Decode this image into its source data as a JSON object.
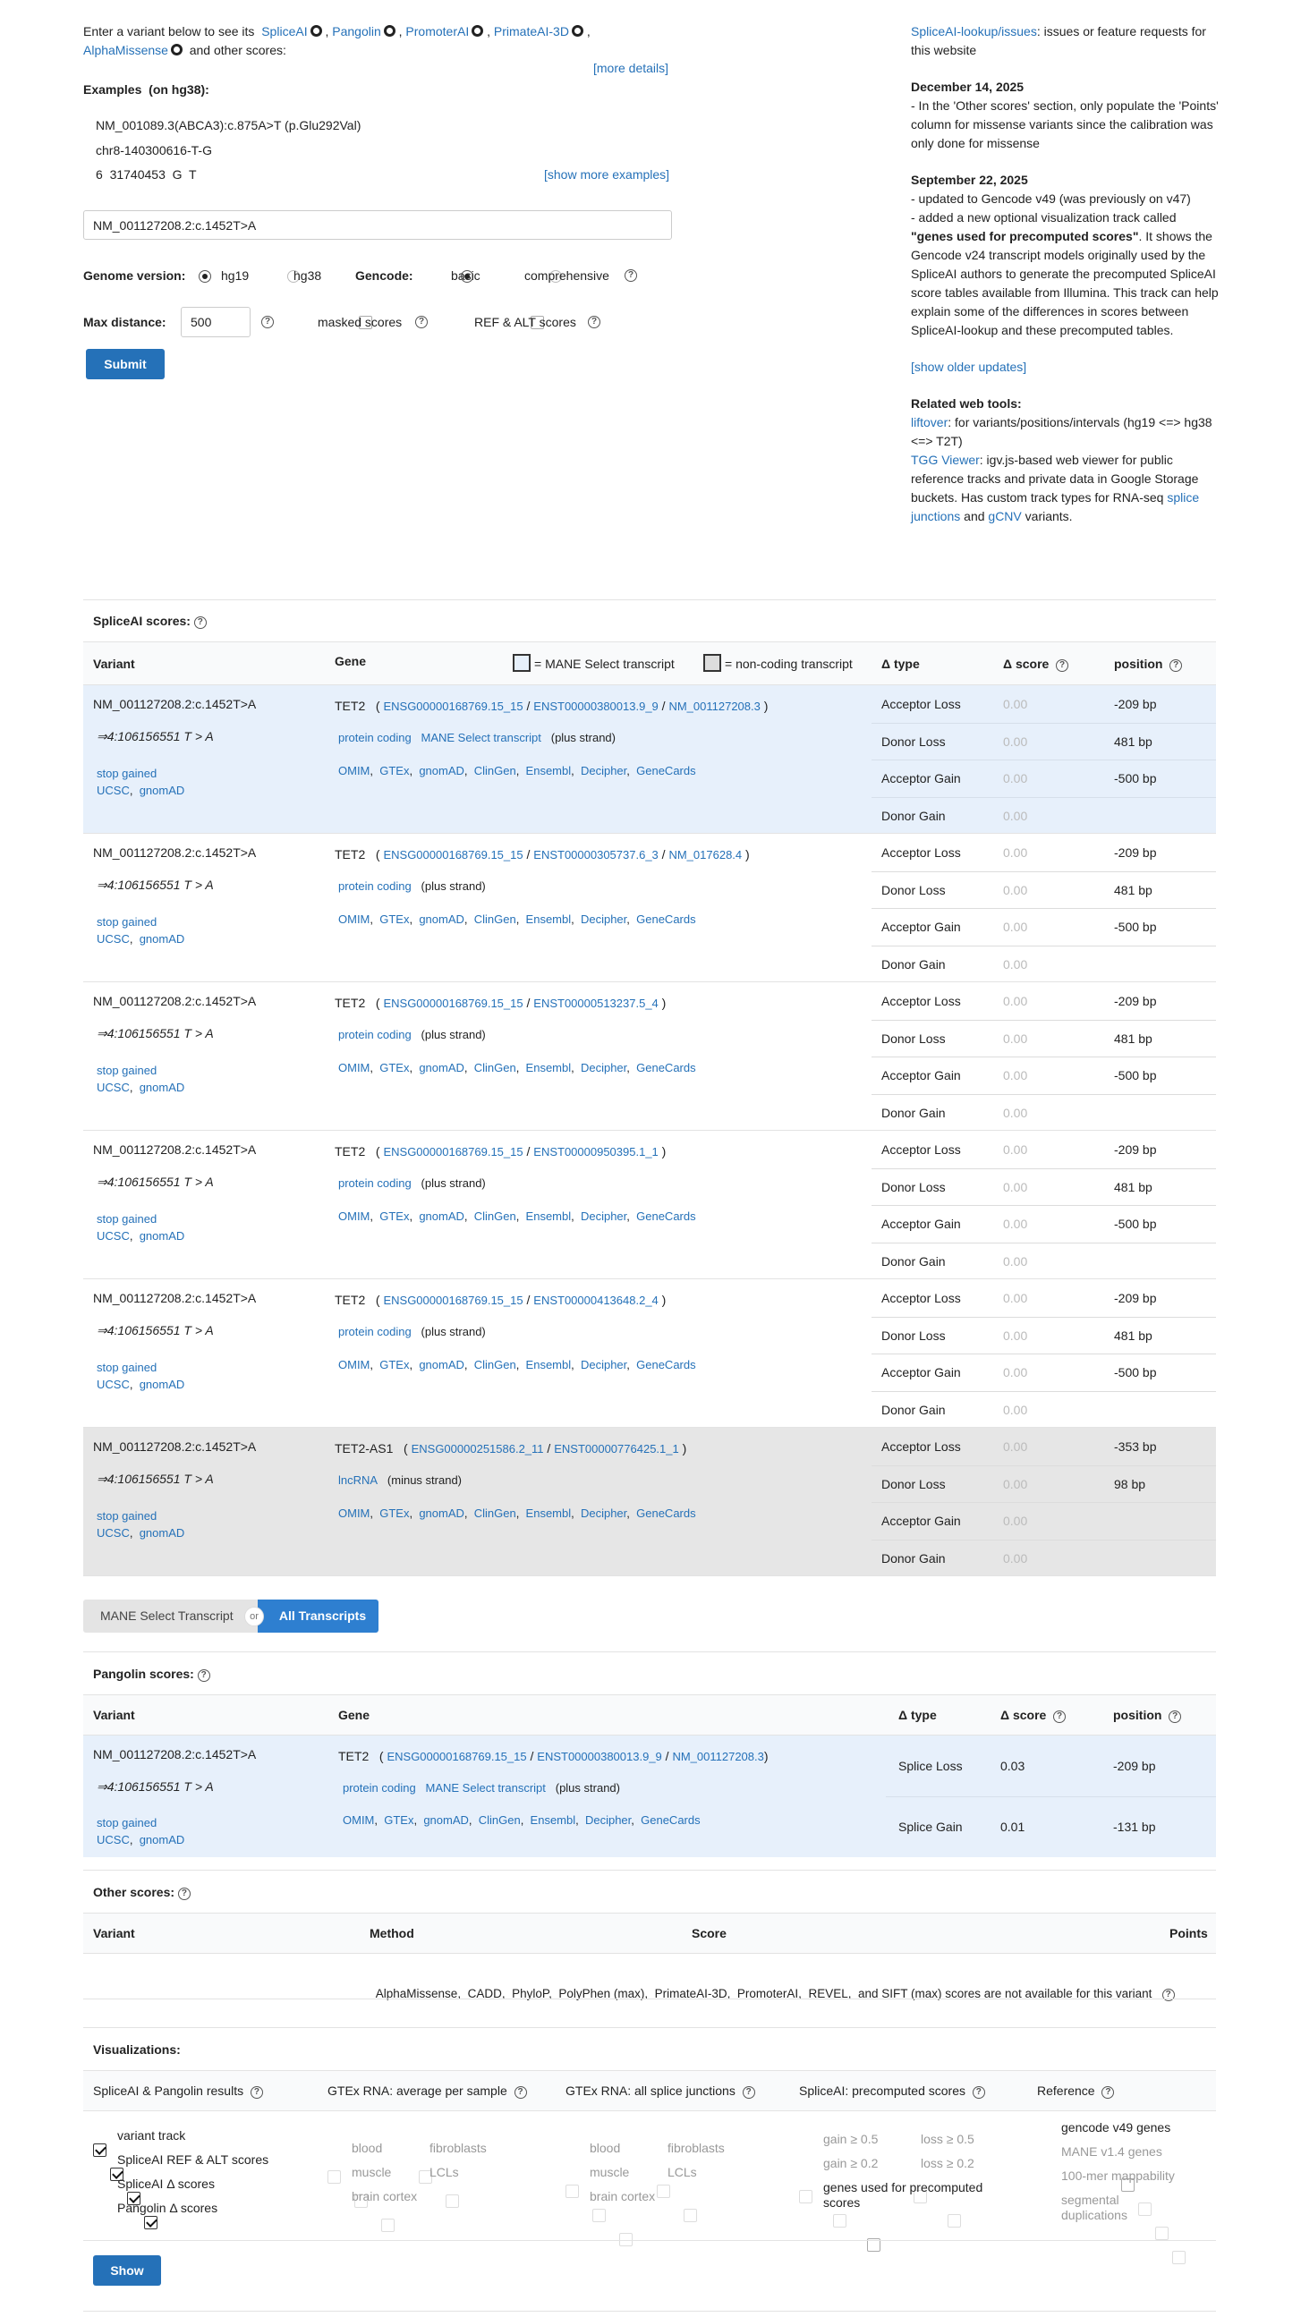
{
  "intro": {
    "prefix": "Enter a variant below to see its",
    "tools": [
      "SpliceAI",
      "Pangolin",
      "PromoterAI",
      "PrimateAI-3D",
      "AlphaMissense"
    ],
    "suffix": "and other scores:",
    "more_details": "[more details]"
  },
  "examples": {
    "heading": "Examples",
    "heading_note": "(on hg38):",
    "items": [
      "NM_001089.3(ABCA3):c.875A>T (p.Glu292Val)",
      "chr8-140300616-T-G",
      "6  31740453  G  T"
    ],
    "show_more": "[show more examples]"
  },
  "search": {
    "value": "NM_001127208.2:c.1452T>A"
  },
  "options": {
    "genome_label": "Genome version:",
    "genome": [
      "hg19",
      "hg38"
    ],
    "gencode_label": "Gencode:",
    "gencode": [
      "basic",
      "comprehensive"
    ],
    "maxdist_label": "Max distance:",
    "maxdist_value": "500",
    "masked": "masked scores",
    "refalt": "REF & ALT scores",
    "submit": "Submit"
  },
  "news": {
    "issues_link": "SpliceAI-lookup/issues",
    "issues_text": ": issues or feature requests for this website",
    "d1": "December 14, 2025",
    "d1_text": "- In the 'Other scores' section, only populate the 'Points' column for missense variants since the calibration was only done for missense",
    "d2": "September 22, 2025",
    "d2_l1": "- updated to Gencode v49 (was previously on v47)",
    "d2_l2a": "- added a new optional visualization track called",
    "d2_l2b": "\"genes used for precomputed scores\"",
    "d2_l2c": ". It shows the Gencode v24 transcript models originally used by the SpliceAI authors to generate the precomputed SpliceAI score tables available from Illumina. This track can help explain some of the differences in scores between SpliceAI-lookup and these precomputed tables.",
    "show_older": "[show older updates]",
    "related": "Related web tools:",
    "liftover": "liftover",
    "liftover_text": ": for variants/positions/intervals (hg19 <=> hg38 <=> T2T)",
    "igv": "TGG Viewer",
    "igv_text": ": igv.js-based web viewer for public reference tracks and private data in Google Storage buckets. Has custom track types for RNA-seq",
    "splice_junctions": "splice junctions",
    "and": "and",
    "gcnv": "gCNV",
    "variants": "variants."
  },
  "spliceai": {
    "title": "SpliceAI scores:",
    "col_variant": "Variant",
    "col_gene": "Gene",
    "mane_legend": "= MANE Select transcript",
    "noncoding_legend": "= non-coding transcript",
    "col_type": "Δ type",
    "col_score": "Δ score",
    "col_pos": "position",
    "variant": "NM_001127208.2:c.1452T>A",
    "variant_pos": "⇒4:106156551 T > A",
    "consequence": "stop gained",
    "ucsc": "UCSC",
    "gnomad": "gnomAD",
    "links": [
      "OMIM",
      "GTEx",
      "gnomAD",
      "ClinGen",
      "Ensembl",
      "Decipher",
      "GeneCards"
    ],
    "types": [
      "Acceptor Loss",
      "Donor Loss",
      "Acceptor Gain",
      "Donor Gain"
    ],
    "rows": [
      {
        "gene": "TET2",
        "ensg": "ENSG00000168769.15_15",
        "enst": "ENST00000380013.9_9",
        "nm": "NM_001127208.3",
        "biotype": "protein coding",
        "mane": "MANE Select transcript",
        "strand": "(plus strand)",
        "scores": [
          "0.00",
          "0.00",
          "0.00",
          "0.00"
        ],
        "positions": [
          "-209 bp",
          "481 bp",
          "-500 bp",
          ""
        ]
      },
      {
        "gene": "TET2",
        "ensg": "ENSG00000168769.15_15",
        "enst": "ENST00000305737.6_3",
        "nm": "NM_017628.4",
        "biotype": "protein coding",
        "mane": "",
        "strand": "(plus strand)",
        "scores": [
          "0.00",
          "0.00",
          "0.00",
          "0.00"
        ],
        "positions": [
          "-209 bp",
          "481 bp",
          "-500 bp",
          ""
        ]
      },
      {
        "gene": "TET2",
        "ensg": "ENSG00000168769.15_15",
        "enst": "ENST00000513237.5_4",
        "nm": "",
        "biotype": "protein coding",
        "mane": "",
        "strand": "(plus strand)",
        "scores": [
          "0.00",
          "0.00",
          "0.00",
          "0.00"
        ],
        "positions": [
          "-209 bp",
          "481 bp",
          "-500 bp",
          ""
        ]
      },
      {
        "gene": "TET2",
        "ensg": "ENSG00000168769.15_15",
        "enst": "ENST00000950395.1_1",
        "nm": "",
        "biotype": "protein coding",
        "mane": "",
        "strand": "(plus strand)",
        "scores": [
          "0.00",
          "0.00",
          "0.00",
          "0.00"
        ],
        "positions": [
          "-209 bp",
          "481 bp",
          "-500 bp",
          ""
        ]
      },
      {
        "gene": "TET2",
        "ensg": "ENSG00000168769.15_15",
        "enst": "ENST00000413648.2_4",
        "nm": "",
        "biotype": "protein coding",
        "mane": "",
        "strand": "(plus strand)",
        "scores": [
          "0.00",
          "0.00",
          "0.00",
          "0.00"
        ],
        "positions": [
          "-209 bp",
          "481 bp",
          "-500 bp",
          ""
        ]
      },
      {
        "gene": "TET2-AS1",
        "ensg": "ENSG00000251586.2_11",
        "enst": "ENST00000776425.1_1",
        "nm": "",
        "biotype": "lncRNA",
        "mane": "",
        "strand": "(minus strand)",
        "scores": [
          "0.00",
          "0.00",
          "0.00",
          "0.00"
        ],
        "positions": [
          "-353 bp",
          "98 bp",
          "",
          ""
        ]
      }
    ]
  },
  "toggle": {
    "mane": "MANE Select Transcript",
    "or": "or",
    "all": "All Transcripts"
  },
  "pangolin": {
    "title": "Pangolin scores:",
    "col_variant": "Variant",
    "col_gene": "Gene",
    "col_type": "Δ type",
    "col_score": "Δ score",
    "col_pos": "position",
    "gene": "TET2",
    "ensg": "ENSG00000168769.15_15",
    "enst": "ENST00000380013.9_9",
    "nm": "NM_001127208.3",
    "biotype": "protein coding",
    "mane": "MANE Select transcript",
    "strand": "(plus strand)",
    "types": [
      "Splice Loss",
      "Splice Gain"
    ],
    "scores": [
      "0.03",
      "0.01"
    ],
    "positions": [
      "-209 bp",
      "-131 bp"
    ]
  },
  "other": {
    "title": "Other scores:",
    "col_variant": "Variant",
    "col_method": "Method",
    "col_score": "Score",
    "col_points": "Points",
    "message": "AlphaMissense,  CADD,  PhyloP,  PolyPhen (max),  PrimateAI-3D,  PromoterAI,  REVEL,  and SIFT (max) scores are not available for this variant"
  },
  "viz": {
    "title": "Visualizations:",
    "col1": "SpliceAI & Pangolin results",
    "col2": "GTEx RNA: average per sample",
    "col3": "GTEx RNA: all splice junctions",
    "col4": "SpliceAI: precomputed scores",
    "col5": "Reference",
    "c1": [
      "variant track",
      "SpliceAI REF & ALT scores",
      "SpliceAI Δ  scores",
      "Pangolin Δ  scores"
    ],
    "tissues": [
      "blood",
      "fibroblasts",
      "muscle",
      "LCLs",
      "brain cortex"
    ],
    "pre": [
      "gain ≥ 0.5",
      "loss ≥ 0.5",
      "gain ≥ 0.2",
      "loss ≥ 0.2"
    ],
    "pre_genes": "genes used for precomputed scores",
    "ref": [
      "gencode v49 genes",
      "MANE v1.4 genes",
      "100-mer mappability",
      "segmental duplications"
    ],
    "show": "Show"
  }
}
